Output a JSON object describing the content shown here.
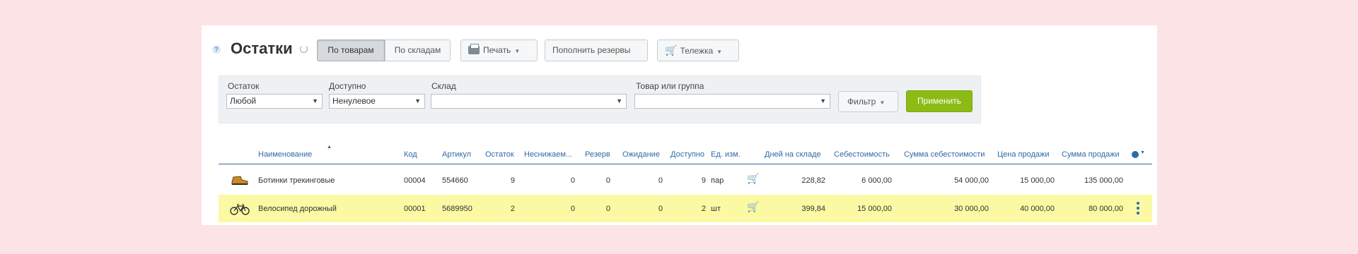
{
  "header": {
    "title": "Остатки",
    "seg_by_goods": "По товарам",
    "seg_by_warehouses": "По складам",
    "print_label": "Печать",
    "refill_label": "Пополнить резервы",
    "cart_label": "Тележка"
  },
  "filters": {
    "remainder_label": "Остаток",
    "remainder_value": "Любой",
    "available_label": "Доступно",
    "available_value": "Ненулевое",
    "warehouse_label": "Склад",
    "warehouse_value": "",
    "product_label": "Товар или группа",
    "product_value": "",
    "filter_button": "Фильтр",
    "apply_button": "Применить"
  },
  "table": {
    "columns": [
      "Наименование",
      "Код",
      "Артикул",
      "Остаток",
      "Неснижаем...",
      "Резерв",
      "Ожидание",
      "Доступно",
      "Ед. изм.",
      "Дней на складе",
      "Себестоимость",
      "Сумма себестоимости",
      "Цена продажи",
      "Сумма продажи"
    ],
    "rows": [
      {
        "name": "Ботинки трекинговые",
        "code": "00004",
        "article": "554660",
        "remainder": "9",
        "minimum": "0",
        "reserve": "0",
        "waiting": "0",
        "available": "9",
        "unit": "пар",
        "days": "228,82",
        "cost": "6 000,00",
        "cost_sum": "54 000,00",
        "price": "15 000,00",
        "price_sum": "135 000,00",
        "icon": "boot-icon"
      },
      {
        "name": "Велосипед дорожный",
        "code": "00001",
        "article": "5689950",
        "remainder": "2",
        "minimum": "0",
        "reserve": "0",
        "waiting": "0",
        "available": "2",
        "unit": "шт",
        "days": "399,84",
        "cost": "15 000,00",
        "cost_sum": "30 000,00",
        "price": "40 000,00",
        "price_sum": "80 000,00",
        "icon": "bike-icon"
      }
    ]
  },
  "colors": {
    "accent": "#2f6aa8",
    "apply": "#8dbb16",
    "highlight": "#fbf9a3",
    "background": "#fce4e6"
  }
}
